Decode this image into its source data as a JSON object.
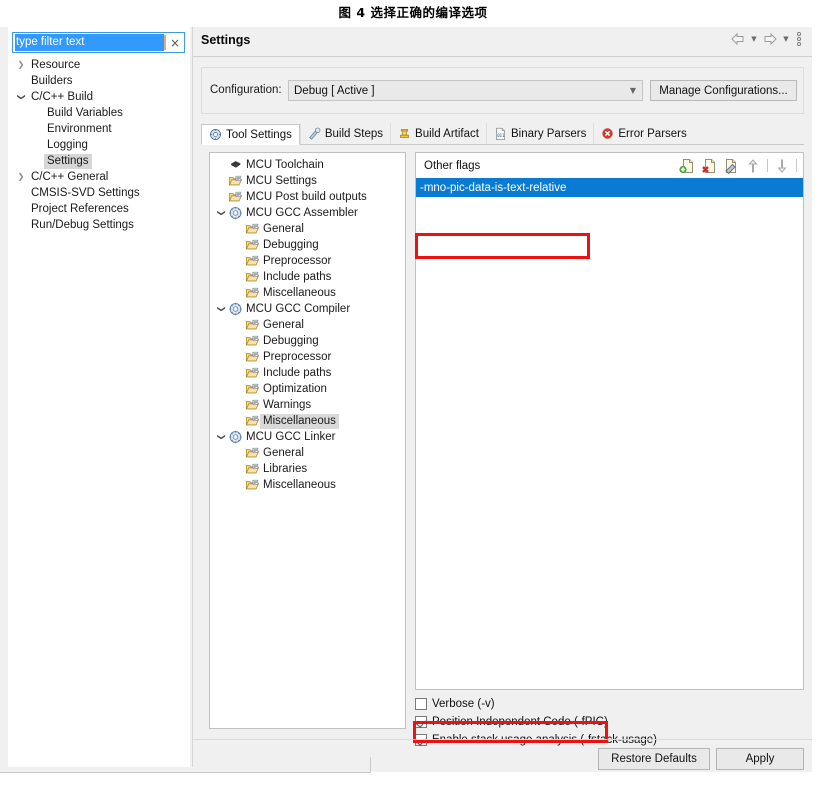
{
  "figure": {
    "caption": "图 4 选择正确的编译选项"
  },
  "filter": {
    "value": "type filter text",
    "clear_label": "×"
  },
  "sidebar": {
    "items": [
      {
        "label": "Resource",
        "indent": 0,
        "arrow": "collapsed",
        "selected": false
      },
      {
        "label": "Builders",
        "indent": 0,
        "arrow": "none",
        "selected": false
      },
      {
        "label": "C/C++ Build",
        "indent": 0,
        "arrow": "expanded",
        "selected": false
      },
      {
        "label": "Build Variables",
        "indent": 1,
        "arrow": "none",
        "selected": false
      },
      {
        "label": "Environment",
        "indent": 1,
        "arrow": "none",
        "selected": false
      },
      {
        "label": "Logging",
        "indent": 1,
        "arrow": "none",
        "selected": false
      },
      {
        "label": "Settings",
        "indent": 1,
        "arrow": "none",
        "selected": true
      },
      {
        "label": "C/C++ General",
        "indent": 0,
        "arrow": "collapsed",
        "selected": false
      },
      {
        "label": "CMSIS-SVD Settings",
        "indent": 0,
        "arrow": "none",
        "selected": false
      },
      {
        "label": "Project References",
        "indent": 0,
        "arrow": "none",
        "selected": false
      },
      {
        "label": "Run/Debug Settings",
        "indent": 0,
        "arrow": "none",
        "selected": false
      }
    ]
  },
  "header": {
    "title": "Settings",
    "back_icon": "back-arrow-icon",
    "forward_icon": "forward-arrow-icon",
    "menu_icon": "view-menu-icon"
  },
  "configuration": {
    "label": "Configuration:",
    "selected": "Debug  [ Active ]",
    "manage_button": "Manage Configurations..."
  },
  "tabs": [
    {
      "label": "Tool Settings",
      "icon": "tool-settings-icon",
      "active": true
    },
    {
      "label": "Build Steps",
      "icon": "build-steps-icon",
      "active": false
    },
    {
      "label": "Build Artifact",
      "icon": "build-artifact-icon",
      "active": false
    },
    {
      "label": "Binary Parsers",
      "icon": "binary-parsers-icon",
      "active": false
    },
    {
      "label": "Error Parsers",
      "icon": "error-parsers-icon",
      "active": false
    }
  ],
  "tool_tree": [
    {
      "label": "MCU Toolchain",
      "indent": 0,
      "arrow": "none",
      "icon": "chip-icon",
      "selected": false
    },
    {
      "label": "MCU Settings",
      "indent": 0,
      "arrow": "none",
      "icon": "folder-icon",
      "selected": false
    },
    {
      "label": "MCU Post build outputs",
      "indent": 0,
      "arrow": "none",
      "icon": "folder-icon",
      "selected": false
    },
    {
      "label": "MCU GCC Assembler",
      "indent": 0,
      "arrow": "expanded",
      "icon": "gear-icon",
      "selected": false
    },
    {
      "label": "General",
      "indent": 1,
      "arrow": "none",
      "icon": "folder-icon",
      "selected": false
    },
    {
      "label": "Debugging",
      "indent": 1,
      "arrow": "none",
      "icon": "folder-icon",
      "selected": false
    },
    {
      "label": "Preprocessor",
      "indent": 1,
      "arrow": "none",
      "icon": "folder-icon",
      "selected": false
    },
    {
      "label": "Include paths",
      "indent": 1,
      "arrow": "none",
      "icon": "folder-icon",
      "selected": false
    },
    {
      "label": "Miscellaneous",
      "indent": 1,
      "arrow": "none",
      "icon": "folder-icon",
      "selected": false
    },
    {
      "label": "MCU GCC Compiler",
      "indent": 0,
      "arrow": "expanded",
      "icon": "gear-icon",
      "selected": false
    },
    {
      "label": "General",
      "indent": 1,
      "arrow": "none",
      "icon": "folder-icon",
      "selected": false
    },
    {
      "label": "Debugging",
      "indent": 1,
      "arrow": "none",
      "icon": "folder-icon",
      "selected": false
    },
    {
      "label": "Preprocessor",
      "indent": 1,
      "arrow": "none",
      "icon": "folder-icon",
      "selected": false
    },
    {
      "label": "Include paths",
      "indent": 1,
      "arrow": "none",
      "icon": "folder-icon",
      "selected": false
    },
    {
      "label": "Optimization",
      "indent": 1,
      "arrow": "none",
      "icon": "folder-icon",
      "selected": false
    },
    {
      "label": "Warnings",
      "indent": 1,
      "arrow": "none",
      "icon": "folder-icon",
      "selected": false
    },
    {
      "label": "Miscellaneous",
      "indent": 1,
      "arrow": "none",
      "icon": "folder-icon",
      "selected": true
    },
    {
      "label": "MCU GCC Linker",
      "indent": 0,
      "arrow": "expanded",
      "icon": "gear-icon",
      "selected": false
    },
    {
      "label": "General",
      "indent": 1,
      "arrow": "none",
      "icon": "folder-icon",
      "selected": false
    },
    {
      "label": "Libraries",
      "indent": 1,
      "arrow": "none",
      "icon": "folder-icon",
      "selected": false
    },
    {
      "label": "Miscellaneous",
      "indent": 1,
      "arrow": "none",
      "icon": "folder-icon",
      "selected": false
    }
  ],
  "options_panel": {
    "title": "Other flags",
    "toolbar": [
      {
        "name": "add-flag-icon"
      },
      {
        "name": "delete-flag-icon"
      },
      {
        "name": "edit-flag-icon"
      },
      {
        "name": "move-up-icon"
      },
      {
        "name": "move-down-icon"
      }
    ],
    "rows": [
      {
        "value": "-mno-pic-data-is-text-relative",
        "selected": true
      }
    ]
  },
  "checkboxes": [
    {
      "label": "Verbose (-v)",
      "checked": false,
      "highlighted": false
    },
    {
      "label": "Position Independent Code (-fPIC)",
      "checked": true,
      "highlighted": true
    },
    {
      "label": "Enable stack usage analysis (-fstack-usage)",
      "checked": true,
      "highlighted": false
    }
  ],
  "buttons": {
    "restore_defaults": "Restore Defaults",
    "apply": "Apply"
  },
  "colors": {
    "selection_blue": "#0a7bd3",
    "annotation_red": "#ee1111",
    "filter_select_blue": "#3399ff",
    "dialog_bg": "#f0f0f0"
  }
}
